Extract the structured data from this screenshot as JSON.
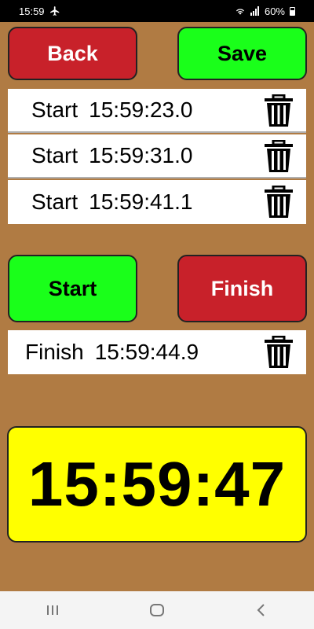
{
  "status_bar": {
    "time": "15:59",
    "battery": "60%"
  },
  "top_buttons": {
    "back_label": "Back",
    "save_label": "Save"
  },
  "start_entries": [
    {
      "label": "Start",
      "time": "15:59:23.0"
    },
    {
      "label": "Start",
      "time": "15:59:31.0"
    },
    {
      "label": "Start",
      "time": "15:59:41.1"
    }
  ],
  "mid_buttons": {
    "start_label": "Start",
    "finish_label": "Finish"
  },
  "finish_entries": [
    {
      "label": "Finish",
      "time": "15:59:44.9"
    }
  ],
  "clock": {
    "time": "15:59:47"
  },
  "colors": {
    "background": "#b07b43",
    "red": "#c8212a",
    "green": "#1aff1a",
    "clock_bg": "#ffff00"
  },
  "icons": {
    "trash": "trash-icon",
    "recent": "recent-apps-icon",
    "home": "home-icon",
    "back": "back-icon"
  }
}
